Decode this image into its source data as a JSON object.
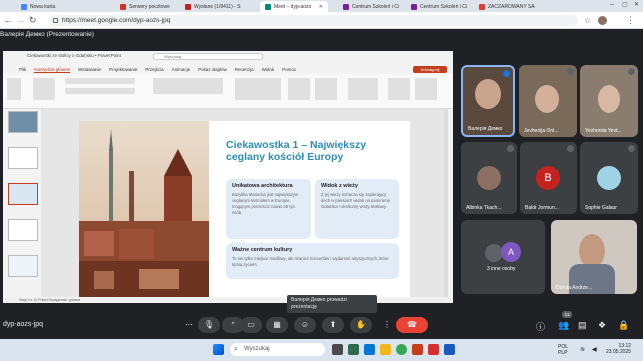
{
  "browser": {
    "tabs": [
      {
        "label": "Nowa karta",
        "color": "#4285f4"
      },
      {
        "label": "Serwery pocztowe",
        "color": "#d93025"
      },
      {
        "label": "Wysłane (1/9411) - S",
        "color": "#c5221f"
      },
      {
        "label": "Meet – dyp-aozs",
        "color": "#00897b"
      },
      {
        "label": "Centrum Szkoleń i Ci",
        "color": "#7b1fa2"
      },
      {
        "label": "Centrum Szkoleń i Ci",
        "color": "#7b1fa2"
      },
      {
        "label": "ZACZAROWANY SA",
        "color": "#e53935"
      }
    ],
    "url": "https://meet.google.com/dyp-aozs-jpq"
  },
  "meet": {
    "presenting_label": "Валерія Демко (Prezentowanie)",
    "meeting_code": "dyp-aozs-jpq",
    "tooltip": "Валерія Демко prowadzi prezentację",
    "participant_count": "11",
    "participants": [
      {
        "name": "Валерія Демко",
        "av": ""
      },
      {
        "name": "Jevhenija Onl...",
        "av": ""
      },
      {
        "name": "Yevheniia Yevt...",
        "av": ""
      },
      {
        "name": "Albinka Tkach...",
        "av": ""
      },
      {
        "name": "Baldr Jormun...",
        "av": "B",
        "color": "#c5221f"
      },
      {
        "name": "Sophie Galaur",
        "av": ""
      },
      {
        "name": "3 inne osoby",
        "av": "A",
        "color": "#7e57c2"
      },
      {
        "name": "Dorota Andrze...",
        "av": ""
      }
    ]
  },
  "ppt": {
    "title": "Ciekawostki ze stolicy o Gdańsku • PowerPoint",
    "search": "Wyszukaj",
    "share": "Udostępnij",
    "menu": [
      "Plik",
      "Narzędzia główne",
      "Wstawianie",
      "Projektowanie",
      "Przejścia",
      "Animacje",
      "Pokaz slajdów",
      "Recenzja",
      "Widok",
      "Pomoc"
    ],
    "selected_menu": 1,
    "status": "Slajd 3 z 10   Polski   Dostępność: gotowe",
    "slide": {
      "title": "Ciekawostka 1 – Największy ceglany kościół Europy",
      "cards": [
        {
          "heading": "Unikatowa architektura",
          "text": "Bazylika Mariacka jest największym ceglanym kościołem w Europie, mogącym pomieścić nawet 25 tys. osób."
        },
        {
          "heading": "Widok z wieży",
          "text": "Z jej wieży roztacza się zapierający dech w piersiach widok na panoramę Gdańska i okolicznę wody Motławy."
        },
        {
          "heading": "Ważne centrum kultury",
          "text": "To nie tylko miejsce modlitwy, ale również koncertów i wydarzeń artystycznych, które tętnią życiem."
        }
      ]
    }
  },
  "taskbar": {
    "search": "Wyszukaj",
    "tray_lang": "POL",
    "tray_layout": "PLP",
    "time": "13:12",
    "date": "23.05.2025"
  }
}
